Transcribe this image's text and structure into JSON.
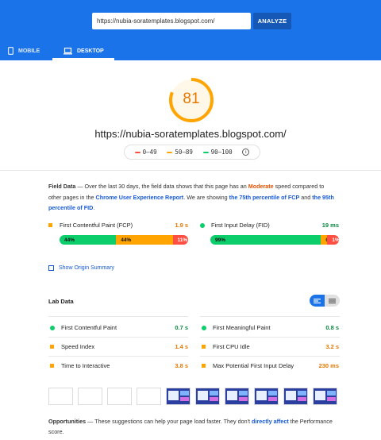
{
  "header": {
    "url_value": "https://nubia-soratemplates.blogspot.com/",
    "analyze_label": "ANALYZE",
    "tabs": [
      {
        "label": "MOBILE",
        "icon": "phone-icon",
        "active": false
      },
      {
        "label": "DESKTOP",
        "icon": "laptop-icon",
        "active": true
      }
    ]
  },
  "score": {
    "value": "81",
    "max": 100,
    "color": "#ffa400",
    "url": "https://nubia-soratemplates.blogspot.com/"
  },
  "legend": {
    "ranges": [
      {
        "label": "0–49",
        "color": "#ff4e42"
      },
      {
        "label": "50–89",
        "color": "#ffa400"
      },
      {
        "label": "90–100",
        "color": "#0cce6b"
      }
    ],
    "info_icon": "info-icon"
  },
  "field_data": {
    "title": "Field Data",
    "desc_1": " — Over the last 30 days, the field data shows that this page has an ",
    "keyword": "Moderate",
    "desc_2": " speed compared to other pages in the ",
    "link_report": "Chrome User Experience Report",
    "desc_3": ". We are showing ",
    "link_fcp": "the 75th percentile of FCP",
    "desc_4": " and ",
    "link_fid": "the 95th percentile of FID",
    "desc_5": ".",
    "metrics": [
      {
        "label": "First Contentful Paint (FCP)",
        "value": "1.9 s",
        "status": "average",
        "distribution": [
          {
            "label": "44%",
            "pct": 44,
            "color": "#0cce6b"
          },
          {
            "label": "44%",
            "pct": 44,
            "color": "#ffa400"
          },
          {
            "label": "11%",
            "pct": 12,
            "color": "#ff4e42"
          }
        ]
      },
      {
        "label": "First Input Delay (FID)",
        "value": "19 ms",
        "status": "fast",
        "distribution": [
          {
            "label": "99%",
            "pct": 86,
            "color": "#0cce6b"
          },
          {
            "label": "0%",
            "pct": 5,
            "color": "#ffa400"
          },
          {
            "label": "1%",
            "pct": 9,
            "color": "#ff4e42"
          }
        ]
      }
    ],
    "origin_summary_label": "Show Origin Summary"
  },
  "lab_data": {
    "title": "Lab Data",
    "metrics": [
      {
        "label": "First Contentful Paint",
        "value": "0.7 s",
        "status": "fast"
      },
      {
        "label": "First Meaningful Paint",
        "value": "0.8 s",
        "status": "fast"
      },
      {
        "label": "Speed Index",
        "value": "1.4 s",
        "status": "average"
      },
      {
        "label": "First CPU Idle",
        "value": "3.2 s",
        "status": "average"
      },
      {
        "label": "Time to Interactive",
        "value": "3.8 s",
        "status": "average"
      },
      {
        "label": "Max Potential First Input Delay",
        "value": "230 ms",
        "status": "average"
      }
    ]
  },
  "filmstrip": {
    "frames": [
      "blank",
      "blank",
      "blank",
      "blank",
      "page",
      "page",
      "page",
      "page",
      "page",
      "page"
    ]
  },
  "opportunities": {
    "title": "Opportunities",
    "desc_1": " — These suggestions can help your page load faster. They don't ",
    "link": "directly affect",
    "desc_2": " the Performance score."
  },
  "colors": {
    "brand_blue": "#1a73e8",
    "fast": "#0cce6b",
    "average": "#ffa400",
    "slow": "#ff4e42"
  }
}
